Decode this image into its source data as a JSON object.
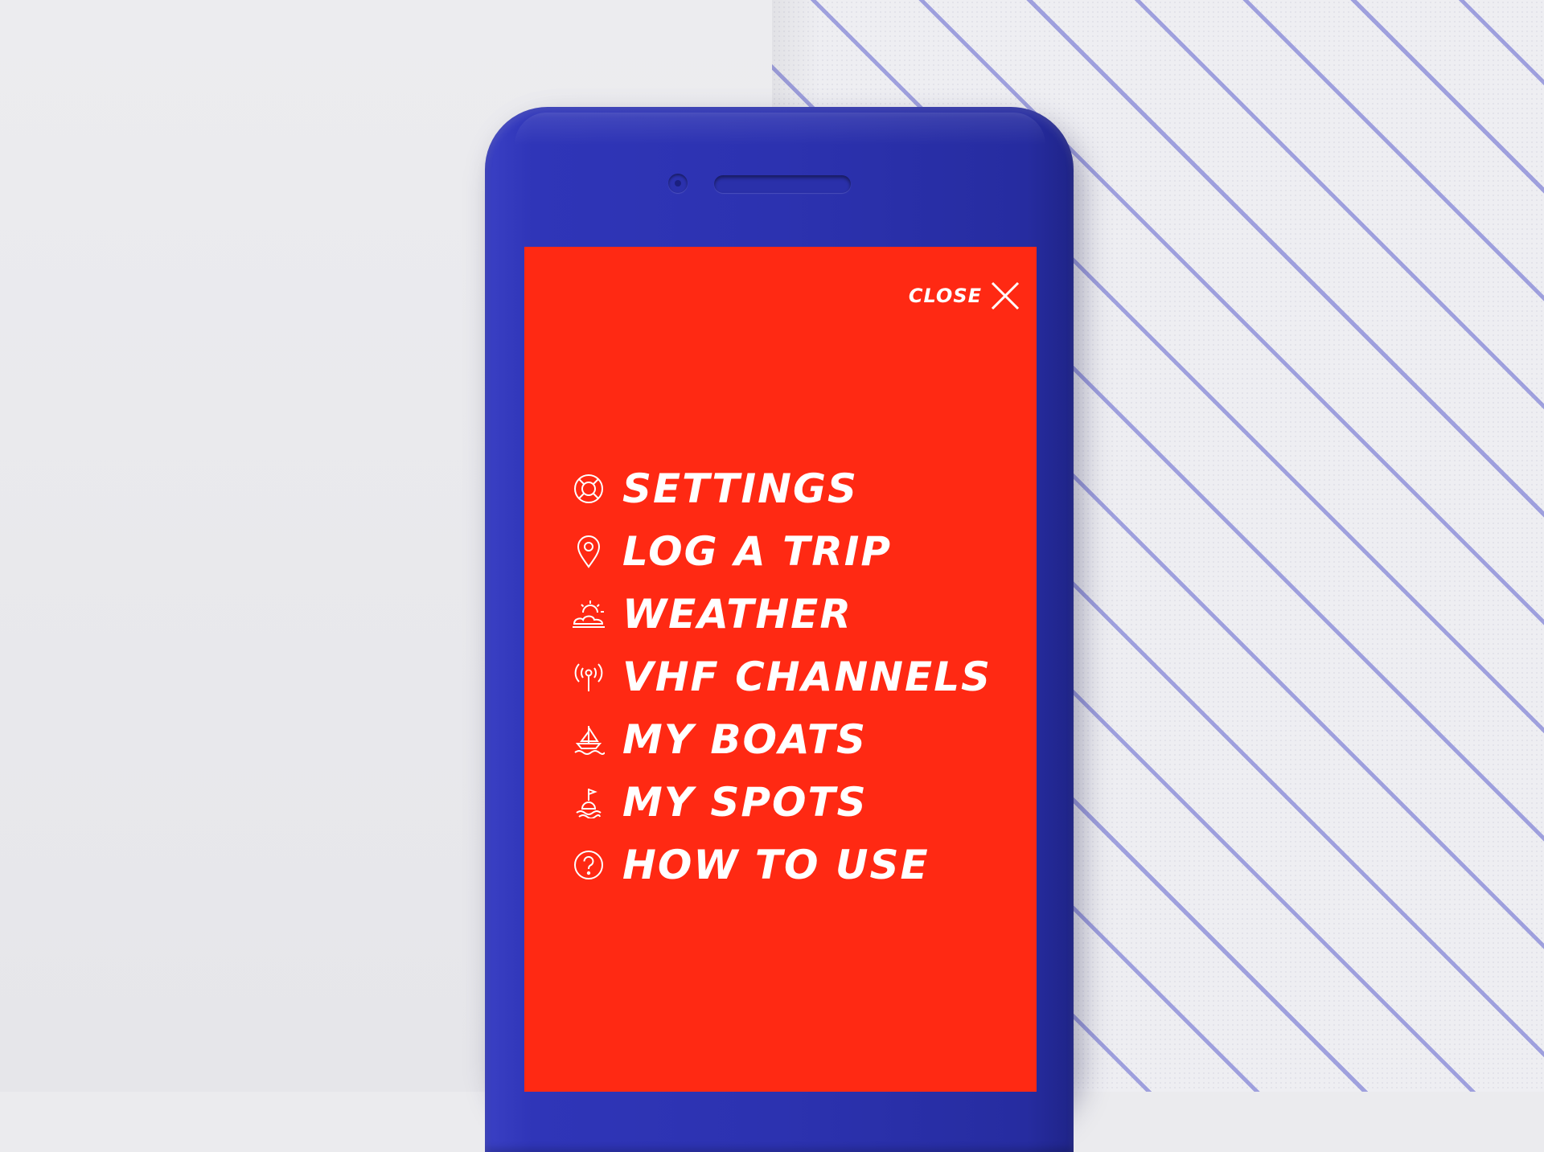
{
  "menu_header": {
    "close_label": "CLOSE",
    "close_icon": "close-icon"
  },
  "menu": {
    "items": [
      {
        "label": "SETTINGS",
        "icon": "lifebuoy-icon"
      },
      {
        "label": "LOG A TRIP",
        "icon": "map-pin-icon"
      },
      {
        "label": "WEATHER",
        "icon": "sun-cloud-icon"
      },
      {
        "label": "VHF CHANNELS",
        "icon": "radio-antenna-icon"
      },
      {
        "label": "MY BOATS",
        "icon": "sailboat-icon"
      },
      {
        "label": "MY SPOTS",
        "icon": "buoy-icon"
      },
      {
        "label": "HOW TO USE",
        "icon": "help-icon"
      }
    ]
  },
  "colors": {
    "screen_background": "#ff2913",
    "phone_body": "#2c32b0",
    "text": "#ffffff",
    "paper_stripes": "#6e70d2"
  }
}
